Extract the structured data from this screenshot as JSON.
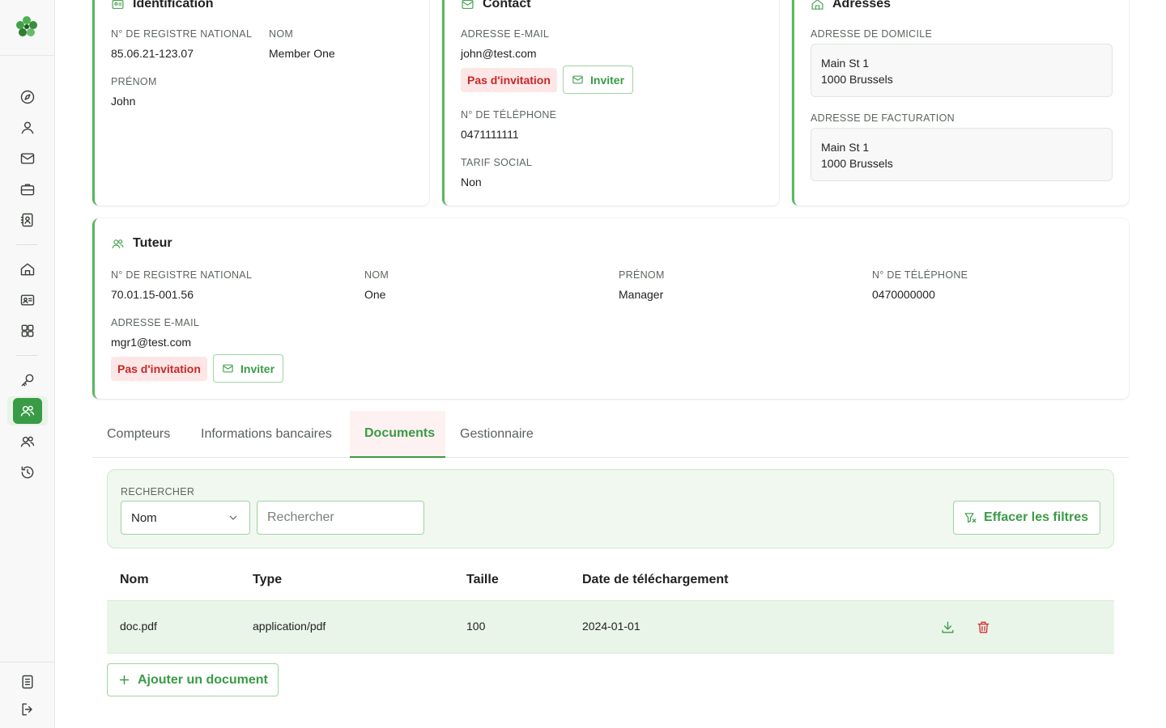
{
  "identification": {
    "title": "Identification",
    "nrn_label": "N° DE REGISTRE NATIONAL",
    "nrn_value": "85.06.21-123.07",
    "nom_label": "NOM",
    "nom_value": "Member One",
    "prenom_label": "PRÉNOM",
    "prenom_value": "John"
  },
  "contact": {
    "title": "Contact",
    "email_label": "ADRESSE E-MAIL",
    "email_value": "john@test.com",
    "invitation_badge": "Pas d'invitation",
    "invite_button": "Inviter",
    "phone_label": "N° DE TÉLÉPHONE",
    "phone_value": "0471111111",
    "tarif_label": "TARIF SOCIAL",
    "tarif_value": "Non"
  },
  "adresses": {
    "title": "Adresses",
    "domicile_label": "ADRESSE DE DOMICILE",
    "domicile_line1": "Main St 1",
    "domicile_line2": "1000 Brussels",
    "facturation_label": "ADRESSE DE FACTURATION",
    "facturation_line1": "Main St 1",
    "facturation_line2": "1000 Brussels"
  },
  "tuteur": {
    "title": "Tuteur",
    "nrn_label": "N° DE REGISTRE NATIONAL",
    "nrn_value": "70.01.15-001.56",
    "nom_label": "NOM",
    "nom_value": "One",
    "prenom_label": "PRÉNOM",
    "prenom_value": "Manager",
    "phone_label": "N° DE TÉLÉPHONE",
    "phone_value": "0470000000",
    "email_label": "ADRESSE E-MAIL",
    "email_value": "mgr1@test.com",
    "invitation_badge": "Pas d'invitation",
    "invite_button": "Inviter"
  },
  "tabs": [
    {
      "label": "Compteurs"
    },
    {
      "label": "Informations bancaires"
    },
    {
      "label": "Documents",
      "active": true
    },
    {
      "label": "Gestionnaire"
    }
  ],
  "filter": {
    "label": "RECHERCHER",
    "select_value": "Nom",
    "search_placeholder": "Rechercher",
    "clear_button": "Effacer les filtres"
  },
  "table": {
    "columns": [
      "Nom",
      "Type",
      "Taille",
      "Date de téléchargement"
    ],
    "rows": [
      {
        "nom": "doc.pdf",
        "type": "application/pdf",
        "taille": "100",
        "date": "2024-01-01"
      }
    ]
  },
  "add_document_button": "Ajouter un document",
  "colors": {
    "accent": "#3a9b46",
    "accent_light": "#e9f5e9",
    "danger": "#c62828",
    "danger_bg": "#fde6e6"
  },
  "icons": {
    "sidebar": [
      "logo-icon",
      "compass-icon",
      "user-icon",
      "mail-icon",
      "briefcase-icon",
      "contact-book-icon",
      "home-icon",
      "id-card-icon",
      "grid-icon",
      "key-icon",
      "users-icon",
      "users-icon",
      "history-icon",
      "document-icon",
      "logout-icon"
    ]
  }
}
